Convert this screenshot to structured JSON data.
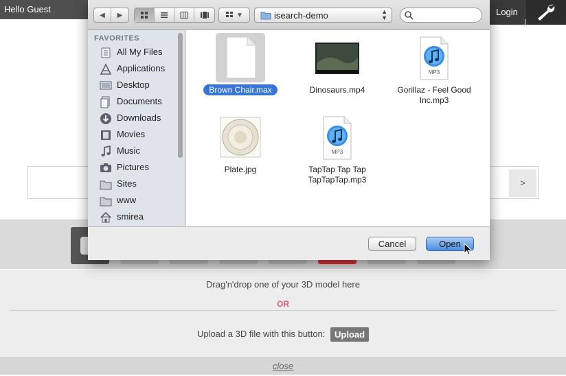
{
  "page": {
    "greeting": "Hello Guest",
    "login_label": "Login",
    "wrench_icon": "wrench-icon",
    "search_go_label": ">",
    "dropzone_text": "Drag'n'drop one of your 3D model here",
    "or_text": "OR",
    "upload_prompt": "Upload a 3D file with this button:",
    "upload_label": "Upload",
    "close_label": "close"
  },
  "dialog": {
    "current_folder": "isearch-demo",
    "search_placeholder": "",
    "favorites_title": "FAVORITES",
    "sidebar": [
      {
        "label": "All My Files",
        "icon": "all-files-icon"
      },
      {
        "label": "Applications",
        "icon": "applications-icon"
      },
      {
        "label": "Desktop",
        "icon": "desktop-icon"
      },
      {
        "label": "Documents",
        "icon": "documents-icon"
      },
      {
        "label": "Downloads",
        "icon": "downloads-icon"
      },
      {
        "label": "Movies",
        "icon": "movies-icon"
      },
      {
        "label": "Music",
        "icon": "music-icon"
      },
      {
        "label": "Pictures",
        "icon": "pictures-icon"
      },
      {
        "label": "Sites",
        "icon": "folder-icon"
      },
      {
        "label": "www",
        "icon": "folder-icon"
      },
      {
        "label": "smirea",
        "icon": "home-icon"
      }
    ],
    "files": [
      {
        "name": "Brown Chair.max",
        "icon": "document-icon",
        "selected": true
      },
      {
        "name": "Dinosaurs.mp4",
        "icon": "video-thumbnail"
      },
      {
        "name": "Gorillaz - Feel Good Inc.mp3",
        "icon": "mp3-icon"
      },
      {
        "name": "Plate.jpg",
        "icon": "image-thumbnail"
      },
      {
        "name": "TapTap Tap Tap TapTapTap.mp3",
        "icon": "mp3-icon"
      }
    ],
    "mp3_badge": "MP3",
    "cancel_label": "Cancel",
    "open_label": "Open"
  },
  "colors": {
    "accent_selection": "#3875d7",
    "or_pink": "#e0607a",
    "topbar": "#4f4f4f"
  }
}
